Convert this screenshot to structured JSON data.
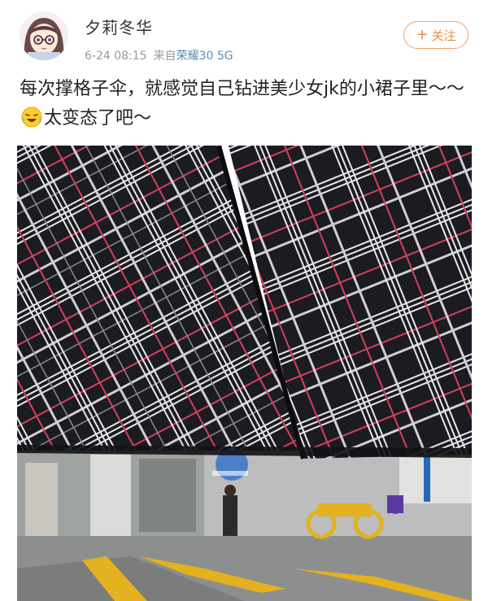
{
  "post": {
    "username": "夕莉冬华",
    "date": "6-24 08:15",
    "source_prefix": "来自",
    "device": "荣耀30 5G",
    "follow_label": "关注",
    "text_part1": "每次撑格子伞，就感觉自己钻进美少女jk的小裙子里～～",
    "text_part2": "太变态了吧～"
  },
  "icons": {
    "avatar": "anime-girl-avatar",
    "follow": "plus-icon",
    "emoji": "laughing-crying-emoji"
  },
  "colors": {
    "follow_accent": "#f08a3c",
    "device_link": "#5b8ab4",
    "umbrella_dark": "#1b1b22",
    "umbrella_red_line": "#d2415a",
    "road_marking": "#e3b21e"
  }
}
